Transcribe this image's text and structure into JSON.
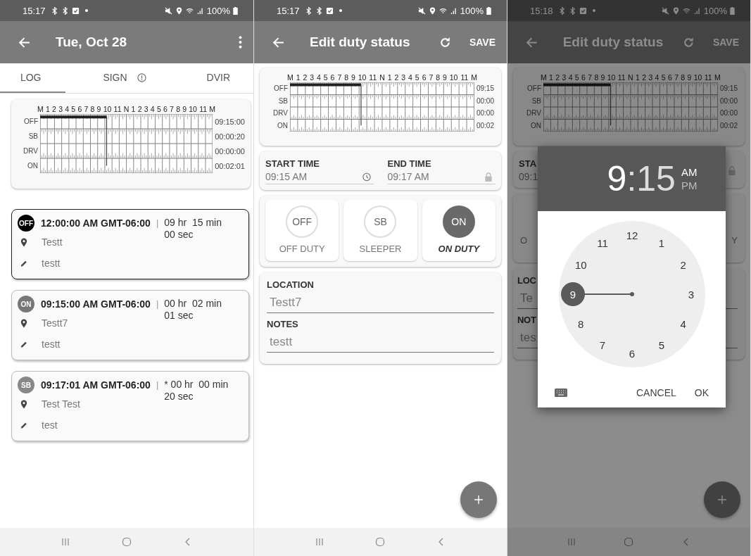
{
  "screens": [
    {
      "kind": "day_log",
      "status_bar": {
        "time": "15:17",
        "battery": "100%"
      },
      "app_bar": {
        "title": "Tue, Oct 28"
      },
      "tabs": [
        {
          "label": "LOG",
          "selected": true,
          "alert": false
        },
        {
          "label": "SIGN",
          "selected": false,
          "alert": true
        },
        {
          "label": "DVIR",
          "selected": false,
          "alert": false
        }
      ],
      "graph": {
        "hour_labels": [
          "M",
          "1",
          "2",
          "3",
          "4",
          "5",
          "6",
          "7",
          "8",
          "9",
          "10",
          "11",
          "N",
          "1",
          "2",
          "3",
          "4",
          "5",
          "6",
          "7",
          "8",
          "9",
          "10",
          "11",
          "M"
        ],
        "rows": [
          {
            "label": "OFF",
            "total": "09:15:00"
          },
          {
            "label": "SB",
            "total": "00:00:20"
          },
          {
            "label": "DRV",
            "total": "00:00:00"
          },
          {
            "label": "ON",
            "total": "00:02:01"
          }
        ]
      },
      "entries": [
        {
          "status": "OFF",
          "color": "#000000",
          "selected": true,
          "time": "12:00:00 AM GMT-06:00",
          "separator": "|",
          "duration": "09 hr  15 min\n00 sec",
          "location": "Testt",
          "note": "testt"
        },
        {
          "status": "ON",
          "color": "#777777",
          "selected": false,
          "time": "09:15:00 AM GMT-06:00",
          "separator": "|",
          "duration": "00 hr  02 min\n01 sec",
          "location": "Testt7",
          "note": "testt"
        },
        {
          "status": "SB",
          "color": "#888888",
          "selected": false,
          "time": "09:17:01 AM GMT-06:00",
          "separator": "|",
          "duration": "* 00 hr  00 min\n20 sec",
          "location": "Test Test",
          "note": "test"
        }
      ]
    },
    {
      "kind": "edit_status",
      "status_bar": {
        "time": "15:17",
        "battery": "100%"
      },
      "app_bar": {
        "title": "Edit duty status",
        "action": "SAVE"
      },
      "graph": {
        "hour_labels": [
          "M",
          "1",
          "2",
          "3",
          "4",
          "5",
          "6",
          "7",
          "8",
          "9",
          "10",
          "11",
          "N",
          "1",
          "2",
          "3",
          "4",
          "5",
          "6",
          "7",
          "8",
          "9",
          "10",
          "11",
          "M"
        ],
        "rows": [
          {
            "label": "OFF",
            "total": "09:15"
          },
          {
            "label": "SB",
            "total": "00:00"
          },
          {
            "label": "DRV",
            "total": "00:00"
          },
          {
            "label": "ON",
            "total": "00:02"
          }
        ]
      },
      "times": [
        {
          "label": "START TIME",
          "value": "09:15 AM",
          "locked": false
        },
        {
          "label": "END TIME",
          "value": "09:17 AM",
          "locked": true
        }
      ],
      "status_options": [
        {
          "code": "OFF",
          "label": "OFF DUTY",
          "selected": false
        },
        {
          "code": "SB",
          "label": "SLEEPER",
          "selected": false
        },
        {
          "code": "ON",
          "label": "ON DUTY",
          "selected": true
        }
      ],
      "location": {
        "label": "LOCATION",
        "value": "Testt7"
      },
      "notes": {
        "label": "NOTES",
        "value": "testt"
      }
    },
    {
      "kind": "time_picker",
      "status_bar": {
        "time": "15:18",
        "battery": "100%"
      },
      "app_bar": {
        "title": "Edit duty status",
        "action": "SAVE"
      },
      "graph": {
        "hour_labels": [
          "M",
          "1",
          "2",
          "3",
          "4",
          "5",
          "6",
          "7",
          "8",
          "9",
          "10",
          "11",
          "N",
          "1",
          "2",
          "3",
          "4",
          "5",
          "6",
          "7",
          "8",
          "9",
          "10",
          "11",
          "M"
        ],
        "rows": [
          {
            "label": "OFF",
            "total": "09:15"
          },
          {
            "label": "SB",
            "total": "00:00"
          },
          {
            "label": "DRV",
            "total": "00:00"
          },
          {
            "label": "ON",
            "total": "00:02"
          }
        ]
      },
      "partial": {
        "start_label": "STA",
        "start_value": "09:1",
        "status_left": "O",
        "status_right": "Y",
        "location_label": "LOC",
        "location_value": "Te",
        "notes_label": "NOT",
        "notes_value": "tes"
      },
      "dialog": {
        "hour": "9",
        "separator": ":",
        "minute": "15",
        "periods": [
          {
            "label": "AM",
            "selected": true
          },
          {
            "label": "PM",
            "selected": false
          }
        ],
        "dial": [
          {
            "label": "12",
            "selected": false
          },
          {
            "label": "1",
            "selected": false
          },
          {
            "label": "2",
            "selected": false
          },
          {
            "label": "3",
            "selected": false
          },
          {
            "label": "4",
            "selected": false
          },
          {
            "label": "5",
            "selected": false
          },
          {
            "label": "6",
            "selected": false
          },
          {
            "label": "7",
            "selected": false
          },
          {
            "label": "8",
            "selected": false
          },
          {
            "label": "9",
            "selected": true
          },
          {
            "label": "10",
            "selected": false
          },
          {
            "label": "11",
            "selected": false
          }
        ],
        "buttons": [
          "CANCEL",
          "OK"
        ]
      }
    }
  ]
}
